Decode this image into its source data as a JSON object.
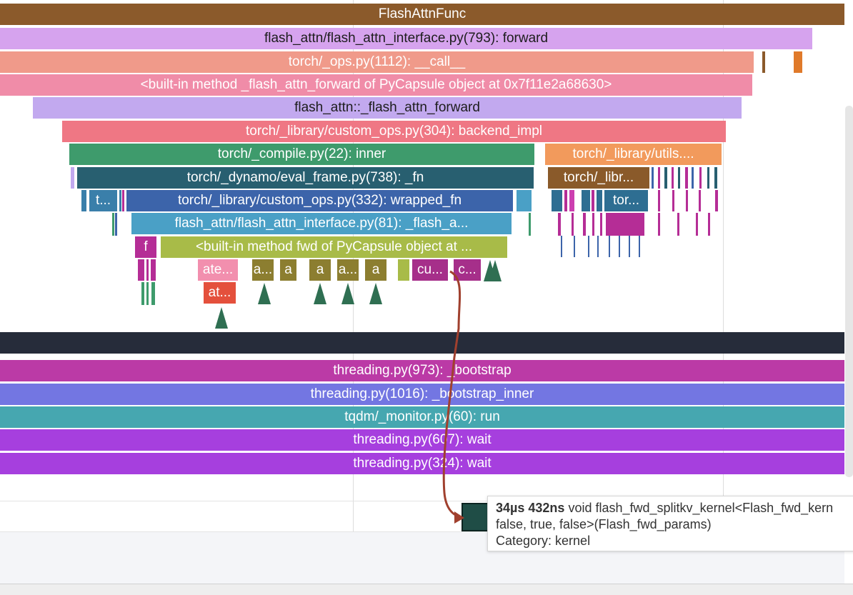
{
  "top_track": {
    "slices": [
      {
        "label": "FlashAttnFunc",
        "color": "#8b5a2b"
      },
      {
        "label": "flash_attn/flash_attn_interface.py(793): forward",
        "color": "#d6a3ee"
      },
      {
        "label": "torch/_ops.py(1112): __call__",
        "color": "#f09a8a"
      },
      {
        "label": "<built-in method _flash_attn_forward of PyCapsule object at 0x7f11e2a68630>",
        "color": "#f08ca8"
      },
      {
        "label": "flash_attn::_flash_attn_forward",
        "color": "#c2a9ef"
      },
      {
        "label": "torch/_library/custom_ops.py(304): backend_impl",
        "color": "#ef7784"
      },
      {
        "label": "torch/_compile.py(22): inner",
        "color": "#3e9b6c"
      },
      {
        "label": "torch/_library/utils....",
        "color": "#f29a5c"
      },
      {
        "label": "torch/_dynamo/eval_frame.py(738): _fn",
        "color": "#285f70"
      },
      {
        "label": "torch/_libr...",
        "color": "#8a5a2a"
      },
      {
        "label": "t...",
        "color": "#3a7faa"
      },
      {
        "label": "torch/_library/custom_ops.py(332): wrapped_fn",
        "color": "#3c64aa"
      },
      {
        "label": "tor...",
        "color": "#2e6e92"
      },
      {
        "label": "flash_attn/flash_attn_interface.py(81): _flash_a...",
        "color": "#4aa0c6"
      },
      {
        "label": "f",
        "color": "#b52d96"
      },
      {
        "label": "<built-in method fwd of PyCapsule object at ...",
        "color": "#a8bb48"
      },
      {
        "label": "ate...",
        "color": "#f28fae"
      },
      {
        "label": "a...",
        "color": "#8c7e30"
      },
      {
        "label": "a",
        "color": "#8c7e30"
      },
      {
        "label": "a",
        "color": "#8c7e30"
      },
      {
        "label": "a...",
        "color": "#8c7e30"
      },
      {
        "label": "a",
        "color": "#8c7e30"
      },
      {
        "label": "cu...",
        "color": "#a62f8a"
      },
      {
        "label": "c...",
        "color": "#a62f8a"
      },
      {
        "label": "at...",
        "color": "#e4503c"
      }
    ]
  },
  "bottom_track": {
    "slices": [
      {
        "label": "threading.py(973): _bootstrap",
        "color": "#bb3aa6"
      },
      {
        "label": "threading.py(1016): _bootstrap_inner",
        "color": "#7376e2"
      },
      {
        "label": "tqdm/_monitor.py(60): run",
        "color": "#46a7b0"
      },
      {
        "label": "threading.py(607): wait",
        "color": "#a63fde"
      },
      {
        "label": "threading.py(324): wait",
        "color": "#a63fde"
      }
    ]
  },
  "tooltip": {
    "duration": "34µs 432ns",
    "name": "void flash_fwd_splitkv_kernel<Flash_fwd_kern",
    "name_cont": "false, true, false>(Flash_fwd_params)",
    "category": "Category: kernel"
  },
  "colors": {
    "separator_bar": "#262c3a",
    "flow_arrow": "#a0402e",
    "kernel_block": "#1f4d46"
  }
}
